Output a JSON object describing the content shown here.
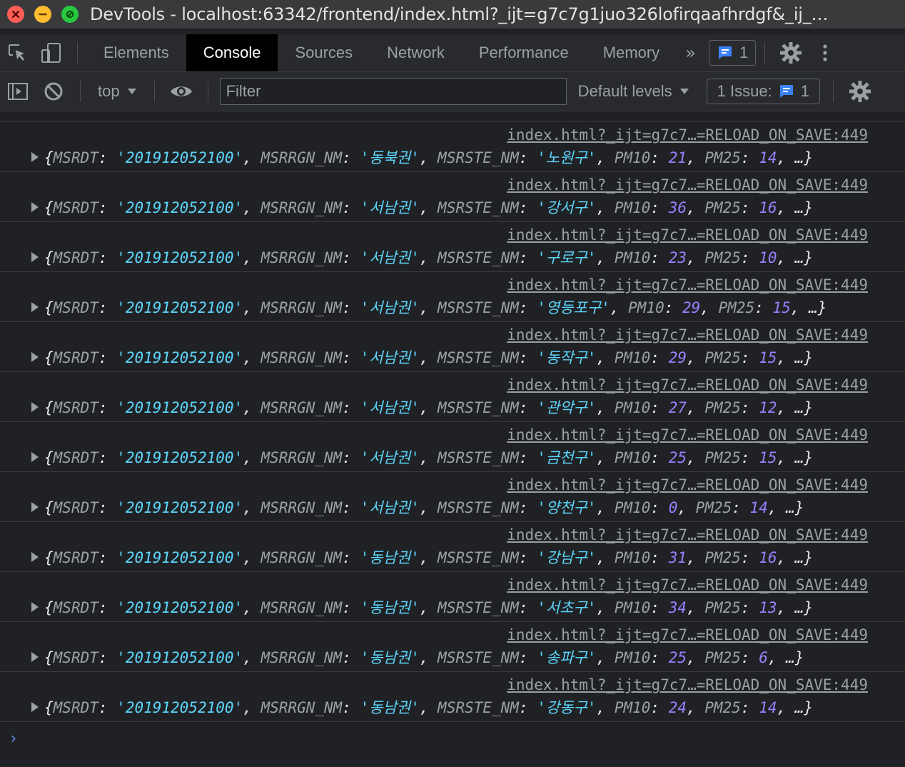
{
  "window": {
    "title": "DevTools - localhost:63342/frontend/index.html?_ijt=g7c7g1juo326lofirqaafhrdgf&_ij_…"
  },
  "tabs": {
    "items": [
      {
        "label": "Elements"
      },
      {
        "label": "Console",
        "active": true
      },
      {
        "label": "Sources"
      },
      {
        "label": "Network"
      },
      {
        "label": "Performance"
      },
      {
        "label": "Memory"
      }
    ],
    "more_glyph": "»",
    "message_count": "1"
  },
  "toolbar": {
    "context": "top",
    "filter_placeholder": "Filter",
    "levels": "Default levels",
    "issues_label": "1 Issue:",
    "issues_count": "1"
  },
  "colors": {
    "background": "#202124",
    "string": "#5cd5fb",
    "number": "#9980ff",
    "active_tab": "#000000"
  },
  "console": {
    "source": "index.html?_ijt=g7c7…=RELOAD_ON_SAVE:449",
    "keys": [
      "MSRDT",
      "MSRRGN_NM",
      "MSRSTE_NM",
      "PM10",
      "PM25"
    ],
    "entries": [
      {
        "MSRDT": "201912052100",
        "MSRRGN_NM": "동북권",
        "MSRSTE_NM": "노원구",
        "PM10": "21",
        "PM25": "14"
      },
      {
        "MSRDT": "201912052100",
        "MSRRGN_NM": "서남권",
        "MSRSTE_NM": "강서구",
        "PM10": "36",
        "PM25": "16"
      },
      {
        "MSRDT": "201912052100",
        "MSRRGN_NM": "서남권",
        "MSRSTE_NM": "구로구",
        "PM10": "23",
        "PM25": "10"
      },
      {
        "MSRDT": "201912052100",
        "MSRRGN_NM": "서남권",
        "MSRSTE_NM": "영등포구",
        "PM10": "29",
        "PM25": "15"
      },
      {
        "MSRDT": "201912052100",
        "MSRRGN_NM": "서남권",
        "MSRSTE_NM": "동작구",
        "PM10": "29",
        "PM25": "15"
      },
      {
        "MSRDT": "201912052100",
        "MSRRGN_NM": "서남권",
        "MSRSTE_NM": "관악구",
        "PM10": "27",
        "PM25": "12"
      },
      {
        "MSRDT": "201912052100",
        "MSRRGN_NM": "서남권",
        "MSRSTE_NM": "금천구",
        "PM10": "25",
        "PM25": "15"
      },
      {
        "MSRDT": "201912052100",
        "MSRRGN_NM": "서남권",
        "MSRSTE_NM": "양천구",
        "PM10": "0",
        "PM25": "14"
      },
      {
        "MSRDT": "201912052100",
        "MSRRGN_NM": "동남권",
        "MSRSTE_NM": "강남구",
        "PM10": "31",
        "PM25": "16"
      },
      {
        "MSRDT": "201912052100",
        "MSRRGN_NM": "동남권",
        "MSRSTE_NM": "서초구",
        "PM10": "34",
        "PM25": "13"
      },
      {
        "MSRDT": "201912052100",
        "MSRRGN_NM": "동남권",
        "MSRSTE_NM": "송파구",
        "PM10": "25",
        "PM25": "6"
      },
      {
        "MSRDT": "201912052100",
        "MSRRGN_NM": "동남권",
        "MSRSTE_NM": "강동구",
        "PM10": "24",
        "PM25": "14"
      }
    ],
    "prompt": "›"
  }
}
